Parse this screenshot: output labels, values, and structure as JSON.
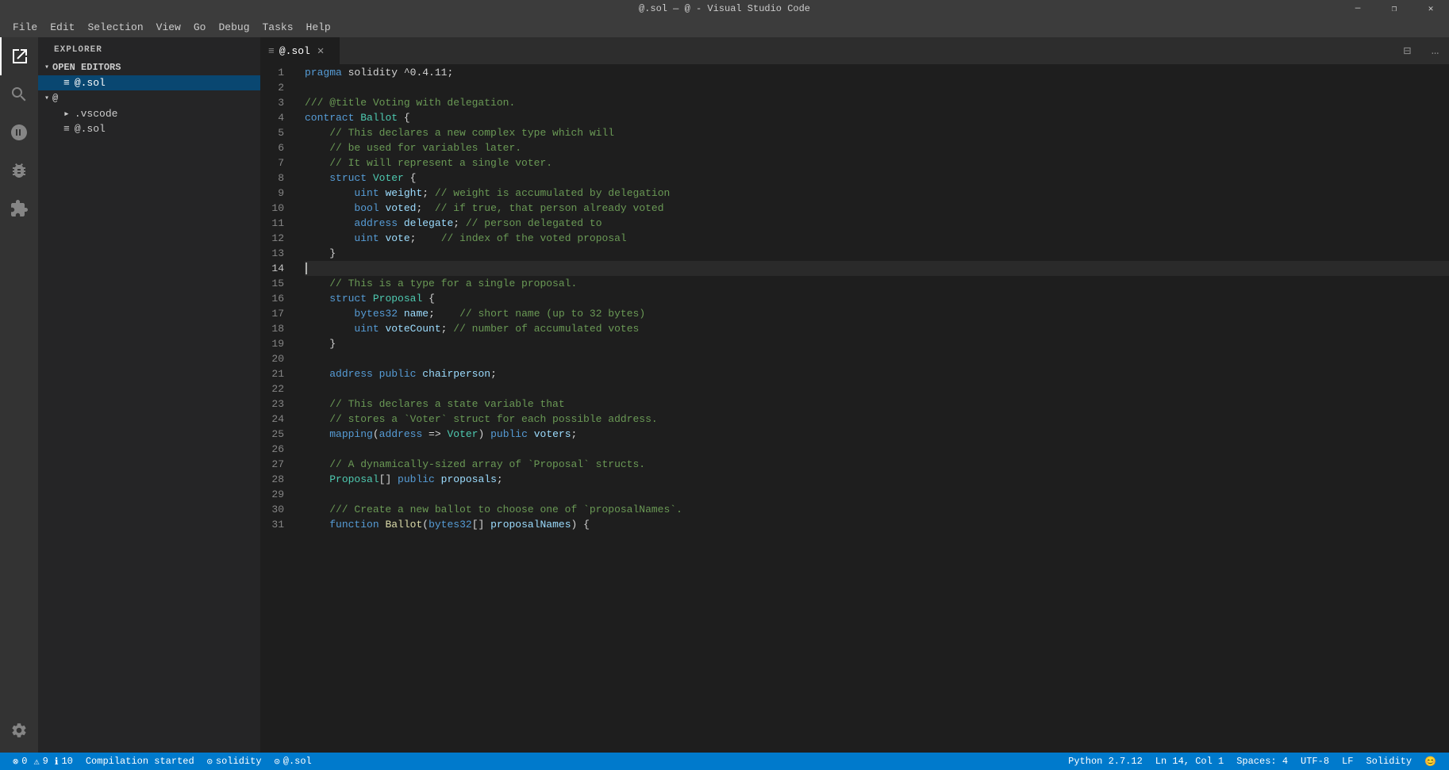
{
  "titlebar": {
    "title": "@.sol — @ - Visual Studio Code",
    "min": "—",
    "max": "❐",
    "close": "✕"
  },
  "menubar": {
    "items": [
      "File",
      "Edit",
      "Selection",
      "View",
      "Go",
      "Debug",
      "Tasks",
      "Help"
    ]
  },
  "activity": {
    "icons": [
      {
        "name": "explorer-icon",
        "symbol": "⎘",
        "active": true
      },
      {
        "name": "search-icon",
        "symbol": "🔍",
        "active": false
      },
      {
        "name": "source-control-icon",
        "symbol": "⑂",
        "active": false
      },
      {
        "name": "debug-icon",
        "symbol": "🚫",
        "active": false
      },
      {
        "name": "extensions-icon",
        "symbol": "⊞",
        "active": false
      }
    ],
    "bottom": [
      {
        "name": "settings-icon",
        "symbol": "⚙"
      }
    ]
  },
  "sidebar": {
    "title": "EXPLORER",
    "sections": [
      {
        "name": "open-editors",
        "label": "OPEN EDITORS",
        "expanded": true,
        "items": [
          {
            "label": "@.sol",
            "icon": "≡",
            "active": true,
            "indent": 1
          }
        ]
      },
      {
        "name": "workspace",
        "label": "@",
        "expanded": true,
        "items": [
          {
            "label": ".vscode",
            "icon": "▸",
            "active": false,
            "indent": 1
          },
          {
            "label": "@.sol",
            "icon": "≡",
            "active": false,
            "indent": 1
          }
        ]
      }
    ]
  },
  "tabs": {
    "items": [
      {
        "label": "@.sol",
        "icon": "≡",
        "active": true,
        "closable": true
      }
    ],
    "split_label": "⊟",
    "more_label": "…"
  },
  "code": {
    "lines": [
      {
        "num": 1,
        "content": "pragma solidity ^0.4.11;",
        "tokens": [
          {
            "text": "pragma",
            "class": "kw"
          },
          {
            "text": " ",
            "class": "plain"
          },
          {
            "text": "solidity",
            "class": "plain"
          },
          {
            "text": " ^0.4.11;",
            "class": "plain"
          }
        ]
      },
      {
        "num": 2,
        "content": ""
      },
      {
        "num": 3,
        "content": "/// @title Voting with delegation.",
        "tokens": [
          {
            "text": "/// @title Voting with delegation.",
            "class": "cmt"
          }
        ]
      },
      {
        "num": 4,
        "content": "contract Ballot {",
        "tokens": [
          {
            "text": "contract",
            "class": "kw"
          },
          {
            "text": " ",
            "class": "plain"
          },
          {
            "text": "Ballot",
            "class": "type"
          },
          {
            "text": " {",
            "class": "plain"
          }
        ]
      },
      {
        "num": 5,
        "content": "    // This declares a new complex type which will",
        "tokens": [
          {
            "text": "    // This declares a new complex type which will",
            "class": "cmt"
          }
        ]
      },
      {
        "num": 6,
        "content": "    // be used for variables later.",
        "tokens": [
          {
            "text": "    // be used for variables later.",
            "class": "cmt"
          }
        ]
      },
      {
        "num": 7,
        "content": "    // It will represent a single voter.",
        "tokens": [
          {
            "text": "    // It will represent a single voter.",
            "class": "cmt"
          }
        ]
      },
      {
        "num": 8,
        "content": "    struct Voter {",
        "tokens": [
          {
            "text": "    ",
            "class": "plain"
          },
          {
            "text": "struct",
            "class": "kw"
          },
          {
            "text": " ",
            "class": "plain"
          },
          {
            "text": "Voter",
            "class": "type"
          },
          {
            "text": " {",
            "class": "plain"
          }
        ]
      },
      {
        "num": 9,
        "content": "        uint weight; // weight is accumulated by delegation",
        "tokens": [
          {
            "text": "        ",
            "class": "plain"
          },
          {
            "text": "uint",
            "class": "kw"
          },
          {
            "text": " ",
            "class": "plain"
          },
          {
            "text": "weight",
            "class": "ident"
          },
          {
            "text": "; ",
            "class": "plain"
          },
          {
            "text": "// weight is accumulated by delegation",
            "class": "cmt"
          }
        ]
      },
      {
        "num": 10,
        "content": "        bool voted;  // if true, that person already voted",
        "tokens": [
          {
            "text": "        ",
            "class": "plain"
          },
          {
            "text": "bool",
            "class": "kw"
          },
          {
            "text": " ",
            "class": "plain"
          },
          {
            "text": "voted",
            "class": "ident"
          },
          {
            "text": ";  ",
            "class": "plain"
          },
          {
            "text": "// if true, that person already voted",
            "class": "cmt"
          }
        ]
      },
      {
        "num": 11,
        "content": "        address delegate; // person delegated to",
        "tokens": [
          {
            "text": "        ",
            "class": "plain"
          },
          {
            "text": "address",
            "class": "kw"
          },
          {
            "text": " ",
            "class": "plain"
          },
          {
            "text": "delegate",
            "class": "ident"
          },
          {
            "text": "; ",
            "class": "plain"
          },
          {
            "text": "// person delegated to",
            "class": "cmt"
          }
        ]
      },
      {
        "num": 12,
        "content": "        uint vote;    // index of the voted proposal",
        "tokens": [
          {
            "text": "        ",
            "class": "plain"
          },
          {
            "text": "uint",
            "class": "kw"
          },
          {
            "text": " ",
            "class": "plain"
          },
          {
            "text": "vote",
            "class": "ident"
          },
          {
            "text": ";    ",
            "class": "plain"
          },
          {
            "text": "// index of the voted proposal",
            "class": "cmt"
          }
        ]
      },
      {
        "num": 13,
        "content": "    }",
        "tokens": [
          {
            "text": "    }",
            "class": "plain"
          }
        ]
      },
      {
        "num": 14,
        "content": "",
        "current": true
      },
      {
        "num": 15,
        "content": "    // This is a type for a single proposal.",
        "tokens": [
          {
            "text": "    // This is a type for a single proposal.",
            "class": "cmt"
          }
        ]
      },
      {
        "num": 16,
        "content": "    struct Proposal {",
        "tokens": [
          {
            "text": "    ",
            "class": "plain"
          },
          {
            "text": "struct",
            "class": "kw"
          },
          {
            "text": " ",
            "class": "plain"
          },
          {
            "text": "Proposal",
            "class": "type"
          },
          {
            "text": " {",
            "class": "plain"
          }
        ]
      },
      {
        "num": 17,
        "content": "        bytes32 name;    // short name (up to 32 bytes)",
        "tokens": [
          {
            "text": "        ",
            "class": "plain"
          },
          {
            "text": "bytes32",
            "class": "kw"
          },
          {
            "text": " ",
            "class": "plain"
          },
          {
            "text": "name",
            "class": "ident"
          },
          {
            "text": ";    ",
            "class": "plain"
          },
          {
            "text": "// short name (up to 32 bytes)",
            "class": "cmt"
          }
        ]
      },
      {
        "num": 18,
        "content": "        uint voteCount; // number of accumulated votes",
        "tokens": [
          {
            "text": "        ",
            "class": "plain"
          },
          {
            "text": "uint",
            "class": "kw"
          },
          {
            "text": " ",
            "class": "plain"
          },
          {
            "text": "voteCount",
            "class": "ident"
          },
          {
            "text": "; ",
            "class": "plain"
          },
          {
            "text": "// number of accumulated votes",
            "class": "cmt"
          }
        ]
      },
      {
        "num": 19,
        "content": "    }",
        "tokens": [
          {
            "text": "    }",
            "class": "plain"
          }
        ]
      },
      {
        "num": 20,
        "content": ""
      },
      {
        "num": 21,
        "content": "    address public chairperson;",
        "tokens": [
          {
            "text": "    ",
            "class": "plain"
          },
          {
            "text": "address",
            "class": "kw"
          },
          {
            "text": " ",
            "class": "plain"
          },
          {
            "text": "public",
            "class": "kw"
          },
          {
            "text": " ",
            "class": "plain"
          },
          {
            "text": "chairperson",
            "class": "ident"
          },
          {
            "text": ";",
            "class": "plain"
          }
        ]
      },
      {
        "num": 22,
        "content": ""
      },
      {
        "num": 23,
        "content": "    // This declares a state variable that",
        "tokens": [
          {
            "text": "    // This declares a state variable that",
            "class": "cmt"
          }
        ]
      },
      {
        "num": 24,
        "content": "    // stores a `Voter` struct for each possible address.",
        "tokens": [
          {
            "text": "    // stores a `Voter` struct for each possible address.",
            "class": "cmt"
          }
        ]
      },
      {
        "num": 25,
        "content": "    mapping(address => Voter) public voters;",
        "tokens": [
          {
            "text": "    ",
            "class": "plain"
          },
          {
            "text": "mapping",
            "class": "kw"
          },
          {
            "text": "(",
            "class": "plain"
          },
          {
            "text": "address",
            "class": "kw"
          },
          {
            "text": " => ",
            "class": "plain"
          },
          {
            "text": "Voter",
            "class": "type"
          },
          {
            "text": ") ",
            "class": "plain"
          },
          {
            "text": "public",
            "class": "kw"
          },
          {
            "text": " ",
            "class": "plain"
          },
          {
            "text": "voters",
            "class": "ident"
          },
          {
            "text": ";",
            "class": "plain"
          }
        ]
      },
      {
        "num": 26,
        "content": ""
      },
      {
        "num": 27,
        "content": "    // A dynamically-sized array of `Proposal` structs.",
        "tokens": [
          {
            "text": "    // A dynamically-sized array of `Proposal` structs.",
            "class": "cmt"
          }
        ]
      },
      {
        "num": 28,
        "content": "    Proposal[] public proposals;",
        "tokens": [
          {
            "text": "    ",
            "class": "plain"
          },
          {
            "text": "Proposal",
            "class": "type"
          },
          {
            "text": "[] ",
            "class": "plain"
          },
          {
            "text": "public",
            "class": "kw"
          },
          {
            "text": " ",
            "class": "plain"
          },
          {
            "text": "proposals",
            "class": "ident"
          },
          {
            "text": ";",
            "class": "plain"
          }
        ]
      },
      {
        "num": 29,
        "content": ""
      },
      {
        "num": 30,
        "content": "    /// Create a new ballot to choose one of `proposalNames`.",
        "tokens": [
          {
            "text": "    /// Create a new ballot to choose one of `proposalNames`.",
            "class": "cmt"
          }
        ]
      },
      {
        "num": 31,
        "content": "    function Ballot(bytes32[] proposalNames) {",
        "tokens": [
          {
            "text": "    ",
            "class": "plain"
          },
          {
            "text": "function",
            "class": "kw"
          },
          {
            "text": " ",
            "class": "plain"
          },
          {
            "text": "Ballot",
            "class": "fn"
          },
          {
            "text": "(",
            "class": "plain"
          },
          {
            "text": "bytes32",
            "class": "kw"
          },
          {
            "text": "[] ",
            "class": "plain"
          },
          {
            "text": "proposalNames",
            "class": "ident"
          },
          {
            "text": ") {",
            "class": "plain"
          }
        ]
      }
    ]
  },
  "statusbar": {
    "left": [
      {
        "name": "errors-status",
        "text": "⊗ 0  ⚠ 9  ℹ 10"
      },
      {
        "name": "compilation-status",
        "text": "Compilation started"
      },
      {
        "name": "solidity-status",
        "text": "⊙ solidity"
      },
      {
        "name": "file-status",
        "text": "⊙ @.sol"
      }
    ],
    "right": [
      {
        "name": "python-status",
        "text": "Python 2.7.12"
      },
      {
        "name": "position-status",
        "text": "Ln 14, Col 1"
      },
      {
        "name": "spaces-status",
        "text": "Spaces: 4"
      },
      {
        "name": "encoding-status",
        "text": "UTF-8"
      },
      {
        "name": "line-ending-status",
        "text": "LF"
      },
      {
        "name": "language-status",
        "text": "Solidity"
      },
      {
        "name": "feedback-icon",
        "text": "😊"
      }
    ]
  }
}
